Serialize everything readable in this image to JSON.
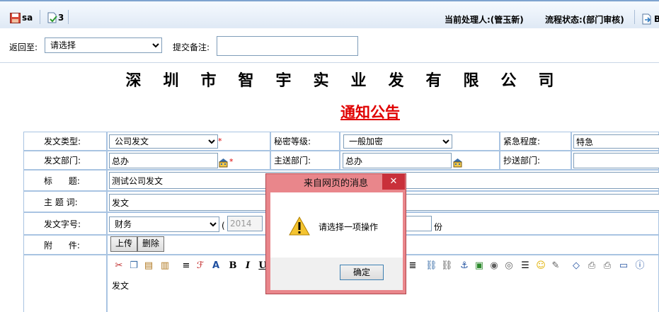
{
  "toolbar": {
    "save_label": "sa",
    "submit_label": "3",
    "current_handler_label": "当前处理人:(管玉新)",
    "flow_status_label": "流程状态:(部门审核)"
  },
  "row2": {
    "return_label": "返回至:",
    "return_select_value": "请选择",
    "remark_label": "提交备注:",
    "remark_value": ""
  },
  "header": {
    "company": "深圳市智宇实业发有限公司",
    "notice_title": "通知公告"
  },
  "form": {
    "doc_type_label": "发文类型:",
    "doc_type_value": "公司发文",
    "secret_label": "秘密等级:",
    "secret_value": "一般加密",
    "urgency_label": "紧急程度:",
    "urgency_value": "特急",
    "dept_label": "发文部门:",
    "dept_value": "总办",
    "main_send_label": "主送部门:",
    "main_send_value": "总办",
    "cc_label": "抄送部门:",
    "cc_value": "",
    "title_label": "标      题:",
    "title_value": "测试公司发文",
    "keyword_label": "主 题 词:",
    "keyword_value": "发文",
    "doc_no_label": "发文字号:",
    "doc_no_value": "财务",
    "paren_open": "(",
    "year_value": "2014",
    "copies_suffix": "份",
    "attach_label": "附      件:",
    "upload_label": "上传",
    "delete_label": "删除",
    "editor_content": "发文"
  },
  "dialog": {
    "title": "来自网页的消息",
    "close_glyph": "✕",
    "message": "请选择一项操作",
    "ok_label": "确定"
  },
  "colors": {
    "accent_red": "#e00000",
    "dialog_frame": "#e9868b",
    "close_red": "#c9303a",
    "grid_border": "#a9c4e2"
  }
}
